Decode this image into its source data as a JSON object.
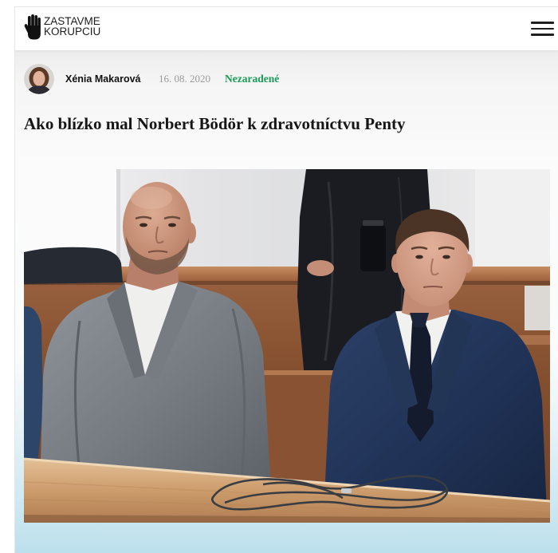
{
  "header": {
    "logo": {
      "line1": "ZASTAVME",
      "line2": "KORUPCIU",
      "icon": "hand-stop-icon"
    },
    "menu_icon": "hamburger-menu-icon"
  },
  "article": {
    "author": "Xénia Makarová",
    "date": "16. 08. 2020",
    "category": "Nezaradené",
    "title": "Ako blízko mal Norbert Bödör k zdravotníctvu Penty"
  },
  "colors": {
    "category": "#1a9c57",
    "title": "#161616",
    "date": "#9a9a9a",
    "page_bottom": "#bde0ed"
  }
}
